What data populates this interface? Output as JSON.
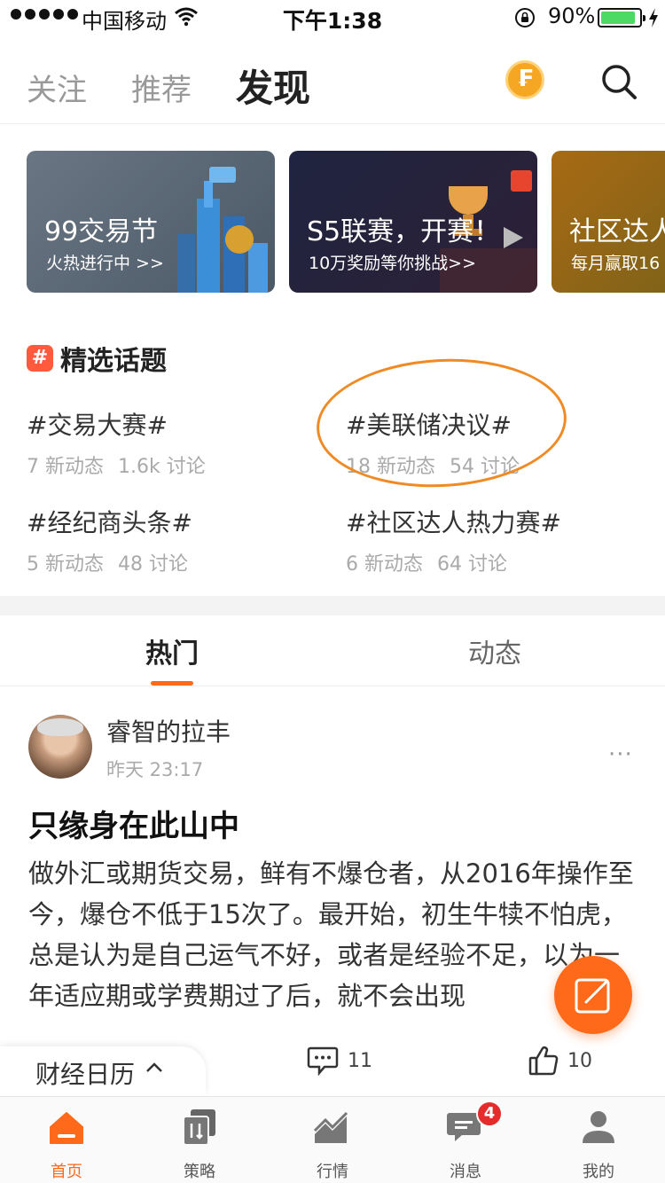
{
  "status_bar": {
    "carrier": "中国移动",
    "time": "下午1:38",
    "battery_percent": "90%",
    "battery_level": 0.9
  },
  "header": {
    "tabs": [
      "关注",
      "推荐",
      "发现"
    ],
    "active_tab": "发现",
    "coin_symbol": "₣",
    "accent_color": "#f5a623"
  },
  "banners": [
    {
      "title": "99交易节",
      "subtitle": "火热进行中 >>"
    },
    {
      "title": "S5联赛，开赛！",
      "subtitle": "10万奖励等你挑战>>"
    },
    {
      "title": "社区达人",
      "subtitle": "每月赢取16"
    }
  ],
  "topics": {
    "section_title": "精选话题",
    "badge_symbol": "#",
    "items": [
      {
        "name": "#交易大赛#",
        "updates": "7 新动态",
        "discussions": "1.6k 讨论"
      },
      {
        "name": "#美联储决议#",
        "updates": "18 新动态",
        "discussions": "54 讨论"
      },
      {
        "name": "#经纪商头条#",
        "updates": "5 新动态",
        "discussions": "48 讨论"
      },
      {
        "name": "#社区达人热力赛#",
        "updates": "6 新动态",
        "discussions": "64 讨论"
      }
    ]
  },
  "feed_tabs": [
    "热门",
    "动态"
  ],
  "post": {
    "author": "睿智的拉丰",
    "time": "昨天 23:17",
    "more": "···",
    "title": "只缘身在此山中",
    "body": " 做外汇或期货交易，鲜有不爆仓者，从2016年操作至今，爆仓不低于15次了。最开始，初生牛犊不怕虎，总是认为是自己运气不好，或者是经验不足，以为一年适应期或学费期过了后，就不会出现"
  },
  "actions": {
    "calendar_label": "财经日历",
    "comments": "11",
    "likes": "10"
  },
  "tabbar": {
    "items": [
      "首页",
      "策略",
      "行情",
      "消息",
      "我的"
    ],
    "active": "首页",
    "message_badge": "4",
    "active_color": "#ff6a1a"
  }
}
